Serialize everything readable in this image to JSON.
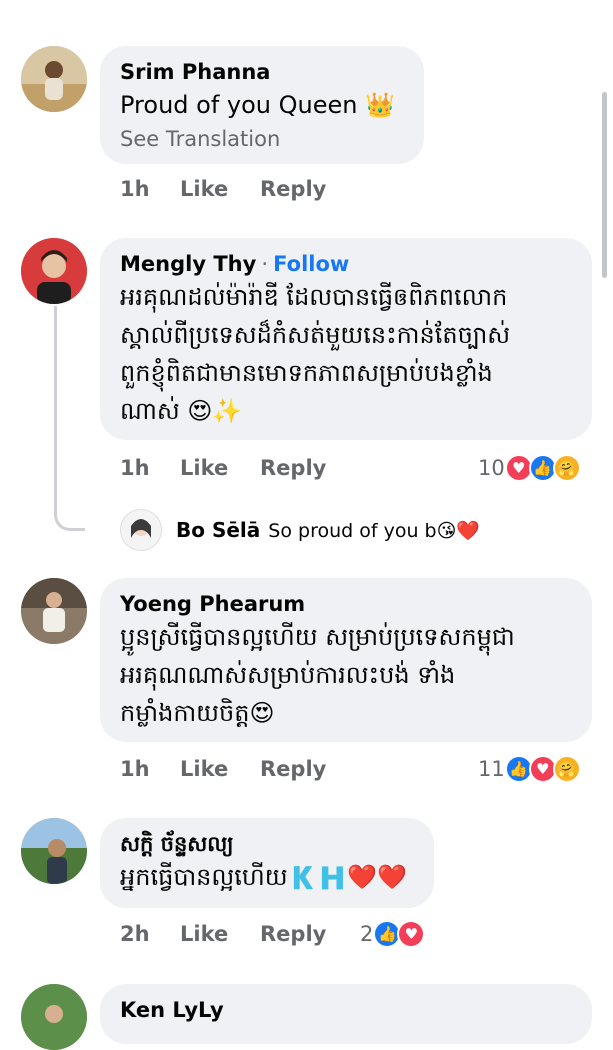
{
  "comments": [
    {
      "author": "Srim Phanna",
      "text": "Proud of you Queen 👑",
      "see_translation": "See Translation",
      "time": "1h",
      "like": "Like",
      "reply": "Reply"
    },
    {
      "author": "Mengly Thy",
      "dot": "·",
      "follow": "Follow",
      "text_lines": [
        "អរគុណដល់ម៉ារ៉ាឌី ដែលបានធ្វើឲពិភពលោក",
        "ស្គាល់ពីប្រទេសដ៏កំសត់មួយនេះកាន់តែច្បាស់",
        "ពួកខ្ញុំពិតជាមានមោទកភាពសម្រាប់បងខ្លាំង",
        "ណាស់ 😍✨"
      ],
      "time": "1h",
      "like": "Like",
      "reply": "Reply",
      "reaction_count": "10"
    },
    {
      "author": "Yoeng Phearum",
      "text_lines": [
        "ប្អូនស្រីធ្វើបានល្អហើយ សម្រាប់ប្រទេសកម្ពុជា",
        "អរគុណណាស់សម្រាប់ការលះបង់ ទាំង",
        "កម្លាំងកាយចិត្ត😍"
      ],
      "time": "1h",
      "like": "Like",
      "reply": "Reply",
      "reaction_count": "11"
    },
    {
      "author": "សក្តិ ច័ន្ទសល្យ",
      "text": "អ្នកធ្វើបានល្អហើយ🇰🇭❤️❤️",
      "time": "2h",
      "like": "Like",
      "reply": "Reply",
      "reaction_count": "2"
    },
    {
      "author": "Ken LyLy"
    }
  ],
  "reply_preview": {
    "author": "Bo Sēlā",
    "text": "So proud of you b😘❤️"
  },
  "colors": {
    "bubble": "#eff1f4",
    "follow": "#1877f2",
    "muted": "#65676b",
    "love": "#f33e58",
    "like": "#1877f2",
    "care": "#f7b125"
  }
}
